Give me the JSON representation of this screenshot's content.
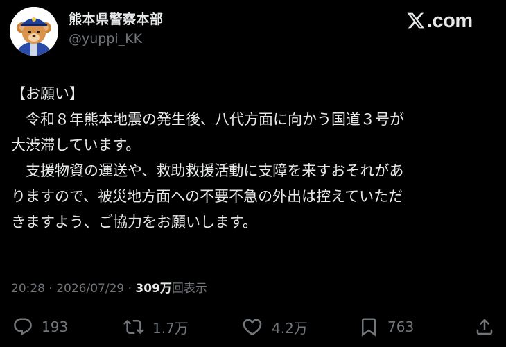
{
  "account": {
    "display_name": "熊本県警察本部",
    "handle": "@yuppi_KK",
    "avatar_icon": "police-bear-mascot-icon"
  },
  "brand": {
    "x_icon": "x-logo-icon",
    "domain_label": ".com"
  },
  "tweet": {
    "lines": [
      "【お願い】",
      "　令和８年熊本地震の発生後、八代方面に向かう国道３号が",
      "大渋滞しています。",
      "　支援物資の運送や、救助救援活動に支障を来すおそれがあ",
      "りますので、被災地方面への不要不急の外出は控えていただ",
      "きますよう、ご協力をお願いします。"
    ]
  },
  "meta": {
    "time": "20:28",
    "separator": " · ",
    "date": "2026/07/29",
    "views_count": "309万",
    "views_label": "回表示"
  },
  "actions": {
    "reply": {
      "icon": "reply-icon",
      "count": "193"
    },
    "repost": {
      "icon": "repost-icon",
      "count": "1.7万"
    },
    "like": {
      "icon": "heart-icon",
      "count": "4.2万"
    },
    "bookmark": {
      "icon": "bookmark-icon",
      "count": "763"
    },
    "share": {
      "icon": "share-icon"
    }
  },
  "colors": {
    "background": "#000000",
    "primary_text": "#e7e9ea",
    "secondary_text": "#71767b"
  }
}
